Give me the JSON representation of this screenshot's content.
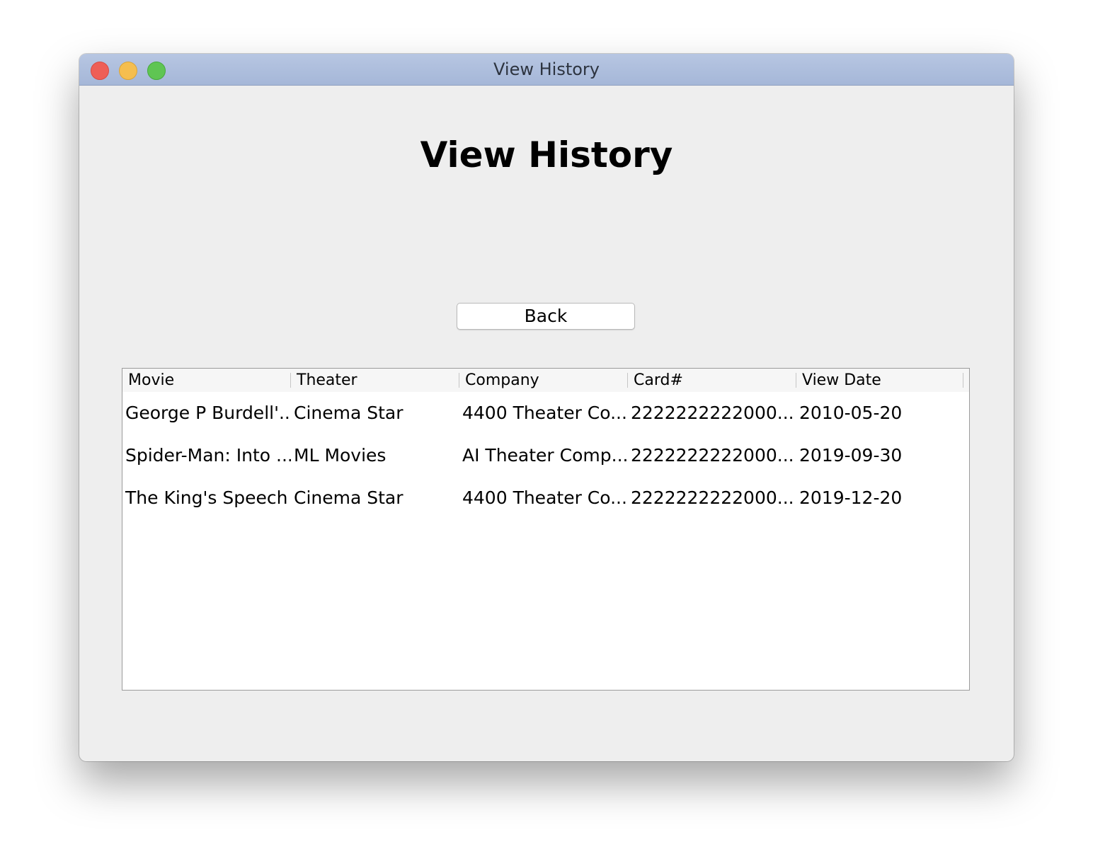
{
  "window": {
    "title": "View History"
  },
  "page": {
    "heading": "View History",
    "back_label": "Back"
  },
  "table": {
    "columns": [
      "Movie",
      "Theater",
      "Company",
      "Card#",
      "View Date"
    ],
    "rows": [
      [
        "George P Burdell'...",
        "Cinema Star",
        "4400 Theater Co...",
        "2222222222000...",
        "2010-05-20"
      ],
      [
        "Spider-Man: Into ...",
        "ML Movies",
        "AI Theater Comp...",
        "2222222222000...",
        "2019-09-30"
      ],
      [
        "The King's Speech",
        "Cinema Star",
        "4400 Theater Co...",
        "2222222222000...",
        "2019-12-20"
      ]
    ]
  },
  "colors": {
    "titlebar": "#a5b7d8",
    "window_bg": "#eeeeee",
    "close": "#ee5f57",
    "minimize": "#f5be4f",
    "maximize": "#5fc553"
  }
}
